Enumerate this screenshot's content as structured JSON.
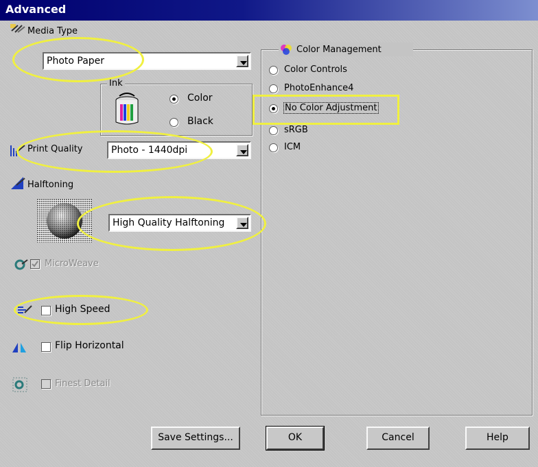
{
  "window": {
    "title": "Advanced"
  },
  "media_type": {
    "label": "Media Type",
    "value": "Photo Paper"
  },
  "ink": {
    "group_label": "Ink",
    "options": [
      {
        "label": "Color",
        "selected": true
      },
      {
        "label": "Black",
        "selected": false
      }
    ]
  },
  "print_quality": {
    "label": "Print Quality",
    "value": "Photo - 1440dpi"
  },
  "halftoning": {
    "label": "Halftoning",
    "value": "High Quality Halftoning"
  },
  "checkboxes": {
    "microweave": {
      "label": "MicroWeave",
      "checked": true,
      "enabled": false
    },
    "high_speed": {
      "label": "High Speed",
      "checked": false,
      "enabled": true
    },
    "flip_horizontal": {
      "label": "Flip Horizontal",
      "checked": false,
      "enabled": true
    },
    "finest_detail": {
      "label": "Finest Detail",
      "checked": false,
      "enabled": false
    }
  },
  "color_management": {
    "group_label": "Color Management",
    "options": [
      {
        "label": "Color Controls",
        "selected": false
      },
      {
        "label": "PhotoEnhance4",
        "selected": false
      },
      {
        "label": "No Color Adjustment",
        "selected": true
      },
      {
        "label": "sRGB",
        "selected": false
      },
      {
        "label": "ICM",
        "selected": false
      }
    ]
  },
  "buttons": {
    "save_settings": "Save Settings...",
    "ok": "OK",
    "cancel": "Cancel",
    "help": "Help"
  },
  "colors": {
    "title_bar": "#00006e",
    "highlight": "#f0f040"
  }
}
